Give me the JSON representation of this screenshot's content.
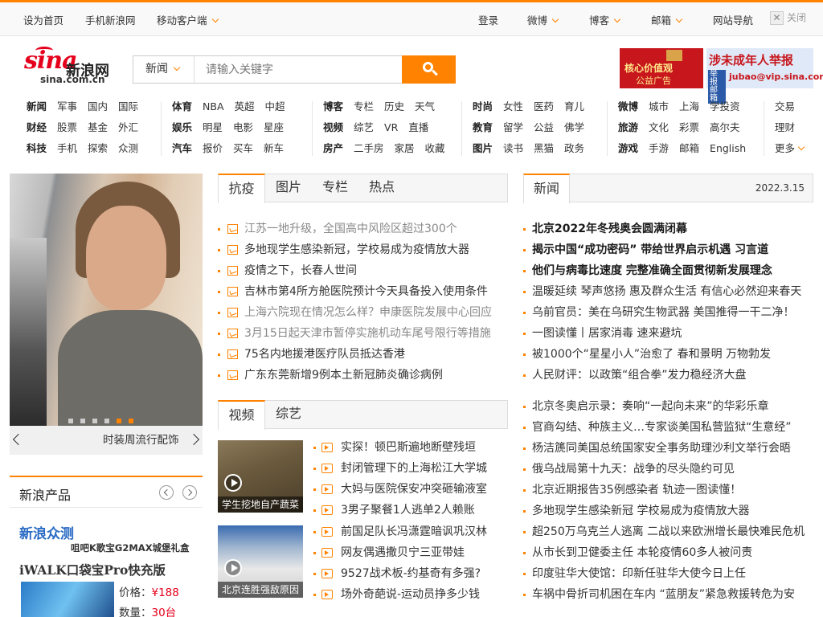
{
  "topbar": {
    "set_home": "设为首页",
    "mobile_sina": "手机新浪网",
    "mobile_client": "移动客户端",
    "login": "登录",
    "weibo": "微博",
    "blog": "博客",
    "mail": "邮箱",
    "site_nav": "网站导航",
    "close": "关闭"
  },
  "logo": {
    "brand": "sina",
    "cn": "新浪网",
    "domain": "sina.com.cn"
  },
  "search": {
    "category": "新闻",
    "placeholder": "请输入关键字"
  },
  "ads": {
    "ad1_title": "核心价值观",
    "ad1_sub": "公益广告",
    "ad2_title": "涉未成年人举报",
    "ad2_badge": "举报邮箱",
    "ad2_mail": "jubao@vip.sina.com"
  },
  "nav": {
    "groups": [
      {
        "rows": [
          [
            "新闻",
            "军事",
            "国内",
            "国际"
          ],
          [
            "财经",
            "股票",
            "基金",
            "外汇"
          ],
          [
            "科技",
            "手机",
            "探索",
            "众测"
          ]
        ]
      },
      {
        "rows": [
          [
            "体育",
            "NBA",
            "英超",
            "中超"
          ],
          [
            "娱乐",
            "明星",
            "电影",
            "星座"
          ],
          [
            "汽车",
            "报价",
            "买车",
            "新车"
          ]
        ]
      },
      {
        "rows": [
          [
            "博客",
            "专栏",
            "历史",
            "天气"
          ],
          [
            "视频",
            "综艺",
            "VR",
            "直播"
          ],
          [
            "房产",
            "二手房",
            "家居",
            "收藏"
          ]
        ]
      },
      {
        "rows": [
          [
            "时尚",
            "女性",
            "医药",
            "育儿"
          ],
          [
            "教育",
            "留学",
            "公益",
            "佛学"
          ],
          [
            "图片",
            "读书",
            "黑猫",
            "政务"
          ]
        ]
      },
      {
        "rows": [
          [
            "微博",
            "城市",
            "上海",
            "学投资"
          ],
          [
            "旅游",
            "文化",
            "彩票",
            "高尔夫"
          ],
          [
            "游戏",
            "手游",
            "邮箱",
            "English"
          ]
        ]
      },
      {
        "rows": [
          [
            "交易"
          ],
          [
            "理财"
          ],
          [
            "更多"
          ]
        ]
      }
    ]
  },
  "slider": {
    "caption": "时装周流行配饰"
  },
  "products": {
    "title": "新浪产品",
    "zhongce": "新浪众测",
    "sub": "咀吧K歌宝G2MAX城堡礼盒",
    "product": "iWALK口袋宝Pro快充版",
    "price_label": "价格：",
    "price": "¥188",
    "qty_label": "数量：",
    "qty": "30台"
  },
  "mid_tabs": [
    "抗疫",
    "图片",
    "专栏",
    "热点"
  ],
  "mid_list": [
    {
      "text": "江苏一地升级，全国高中风险区超过300个",
      "lite": true
    },
    {
      "text": "多地现学生感染新冠，学校易成为疫情放大器",
      "lite": false
    },
    {
      "text": "疫情之下，长春人世间",
      "lite": false
    },
    {
      "text": "吉林市第4所方舱医院预计今天具备投入使用条件",
      "lite": false
    },
    {
      "text": "上海六院现在情况怎么样？申康医院发展中心回应",
      "lite": true
    },
    {
      "text": "3月15日起天津市暂停实施机动车尾号限行等措施",
      "lite": true
    },
    {
      "text": "75名内地援港医疗队员抵达香港",
      "lite": false
    },
    {
      "text": "广东东莞新增9例本土新冠肺炎确诊病例",
      "lite": false
    }
  ],
  "video_tabs": [
    "视频",
    "综艺"
  ],
  "video_thumbs": [
    {
      "caption": "学生挖地自产蔬菜"
    },
    {
      "caption": "北京连胜强敌原因"
    }
  ],
  "video_list": [
    "实探！顿巴斯遍地断壁残垣",
    "封闭管理下的上海松江大学城",
    "大妈与医院保安冲突砸输液室",
    "3男子聚餐1人逃单2人赖账",
    "前国足队长冯潇霆暗讽巩汉林",
    "网友偶遇撒贝宁三亚带娃",
    "9527战术板-约基奇有多强?",
    "场外奇葩说-运动员挣多少钱"
  ],
  "news": {
    "tab": "新闻",
    "date": "2022.3.15",
    "top": [
      {
        "text": "北京2022年冬残奥会圆满闭幕",
        "bold": true
      },
      {
        "text": "揭示中国“成功密码” 带给世界启示机遇 习言道",
        "bold": true
      },
      {
        "text": "他们与病毒比速度 完整准确全面贯彻新发展理念",
        "bold": true
      },
      {
        "text": "温暖延续 琴声悠扬 惠及群众生活 有信心必然迎来春天",
        "bold": false
      },
      {
        "text": "乌前官员：美在乌研究生物武器 美国推得一干二净！",
        "bold": false
      },
      {
        "text": "一图读懂丨居家消毒 速来避坑",
        "bold": false
      },
      {
        "text": "被1000个“星星小人”治愈了 春和景明 万物勃发",
        "bold": false
      },
      {
        "text": "人民财评：以政策“组合拳”发力稳经济大盘",
        "bold": false
      }
    ],
    "more": [
      "北京冬奥启示录：奏响“一起向未来”的华彩乐章",
      "官商勾结、种族主义…专家谈美国私营监狱“生意经”",
      "杨洁篪同美国总统国家安全事务助理沙利文举行会晤",
      "俄乌战局第十九天：战争的尽头隐约可见",
      "北京近期报告35例感染者 轨迹一图读懂！",
      "多地现学生感染新冠 学校易成为疫情放大器",
      "超250万乌克兰人逃离 二战以来欧洲增长最快难民危机",
      "从市长到卫健委主任 本轮疫情60多人被问责",
      "印度驻华大使馆：印新任驻华大使今日上任",
      "车祸中骨折司机困在车内 “蓝朋友”紧急救援转危为安"
    ]
  },
  "colors": {
    "accent": "#ff8200",
    "brand": "#e5001c",
    "link_blue": "#2a6bc4"
  }
}
